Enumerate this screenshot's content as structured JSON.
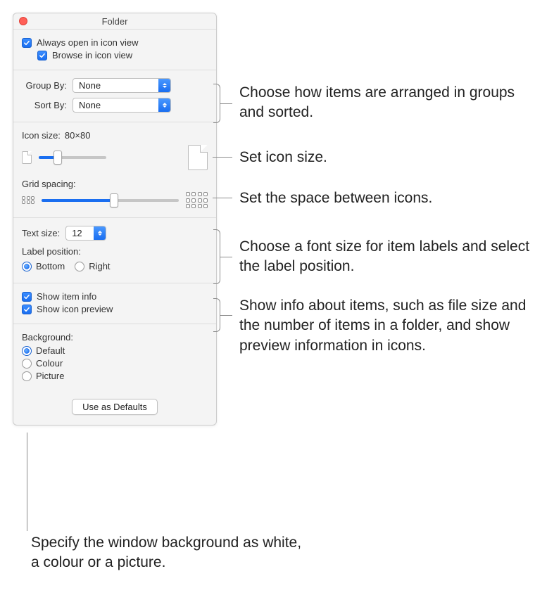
{
  "window": {
    "title": "Folder"
  },
  "checks": {
    "always_open": "Always open in icon view",
    "browse_in_icon": "Browse in icon view",
    "show_item_info": "Show item info",
    "show_icon_preview": "Show icon preview"
  },
  "sort": {
    "group_by_label": "Group By:",
    "group_by_value": "None",
    "sort_by_label": "Sort By:",
    "sort_by_value": "None"
  },
  "icon": {
    "size_label": "Icon size:",
    "size_value": "80×80",
    "grid_label": "Grid spacing:"
  },
  "text": {
    "size_label": "Text size:",
    "size_value": "12",
    "labelpos_label": "Label position:",
    "radio_bottom": "Bottom",
    "radio_right": "Right"
  },
  "background": {
    "heading": "Background:",
    "default": "Default",
    "colour": "Colour",
    "picture": "Picture"
  },
  "button": {
    "defaults": "Use as Defaults"
  },
  "callouts": {
    "c1": "Choose how items are arranged in groups and sorted.",
    "c2": "Set icon size.",
    "c3": "Set the space between icons.",
    "c4": "Choose a font size for item labels and select the label position.",
    "c5": "Show info about items, such as file size and the number of items in a folder, and show preview information in icons.",
    "c6": "Specify the window background as white, a colour or a picture."
  }
}
